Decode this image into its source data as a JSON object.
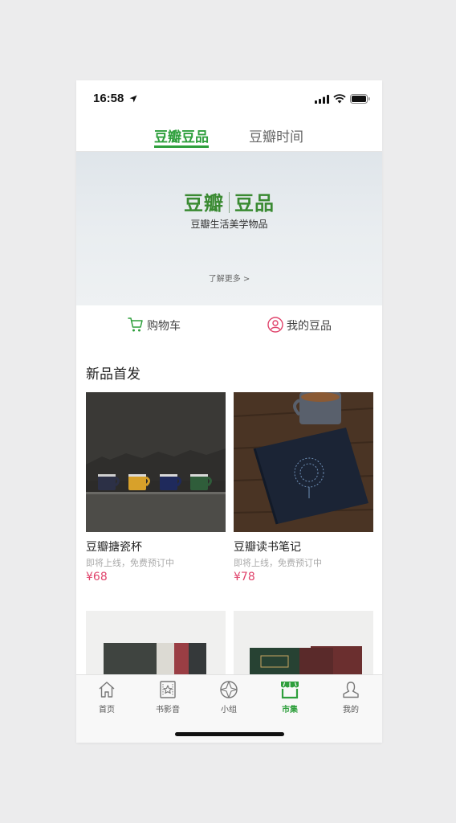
{
  "status_bar": {
    "time": "16:58"
  },
  "top_tabs": [
    {
      "label": "豆瓣豆品",
      "active": true
    },
    {
      "label": "豆瓣时间",
      "active": false
    }
  ],
  "banner": {
    "logo_left": "豆瓣",
    "logo_right": "豆品",
    "subtitle": "豆瓣生活美学物品",
    "more_link": "了解更多 >"
  },
  "shortcuts": {
    "cart": "购物车",
    "my_goods": "我的豆品"
  },
  "section": {
    "title": "新品首发"
  },
  "products": [
    {
      "name": "豆瓣搪瓷杯",
      "status": "即将上线，免费预订中",
      "price": "¥68",
      "icon": "enamel-mugs-photo"
    },
    {
      "name": "豆瓣读书笔记",
      "status": "即将上线，免费预订中",
      "price": "¥78",
      "icon": "notebook-coffee-photo"
    },
    {
      "icon": "notebooks-stack-photo"
    },
    {
      "icon": "boxed-notebooks-photo"
    }
  ],
  "bottom_nav": [
    {
      "label": "首页",
      "icon": "home-icon",
      "active": false
    },
    {
      "label": "书影音",
      "icon": "book-movie-music-icon",
      "active": false
    },
    {
      "label": "小组",
      "icon": "group-icon",
      "active": false
    },
    {
      "label": "市集",
      "icon": "market-icon",
      "active": true
    },
    {
      "label": "我的",
      "icon": "profile-icon",
      "active": false
    }
  ],
  "colors": {
    "accent_green": "#2e9f3c",
    "price_pink": "#e0446c",
    "banner_logo_green": "#3a8a32"
  }
}
